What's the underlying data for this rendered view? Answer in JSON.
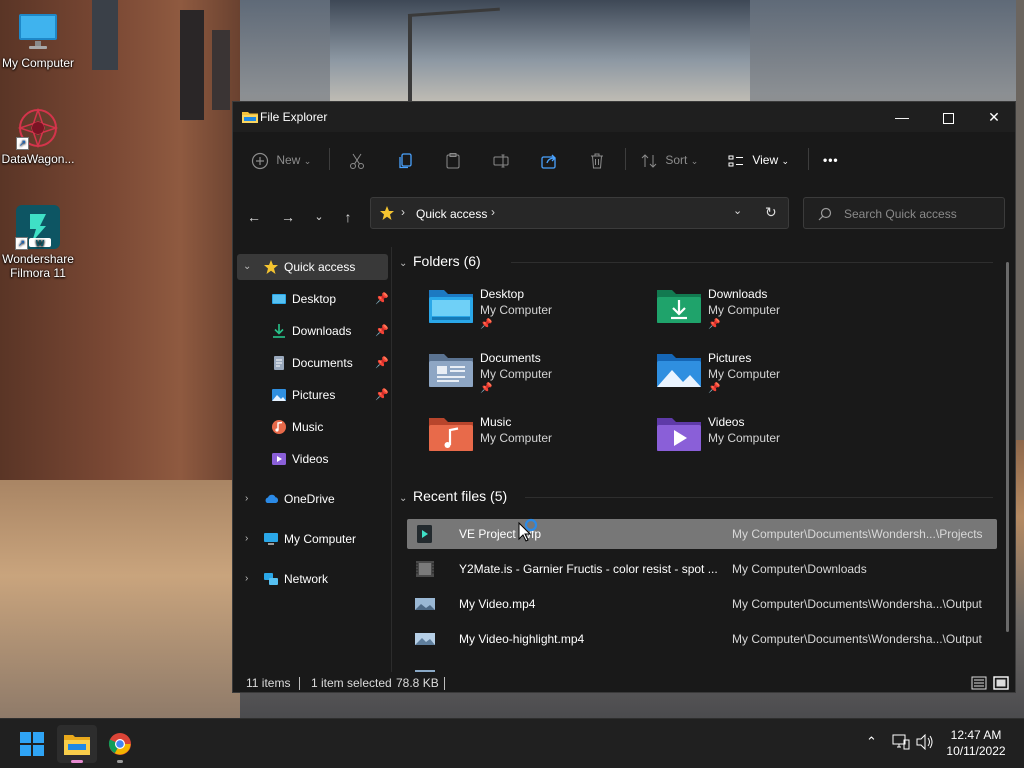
{
  "desktop": {
    "icons": [
      {
        "label": "My Computer",
        "icon": "monitor-icon"
      },
      {
        "label": "DataWagon...",
        "icon": "datawagon-app-icon"
      },
      {
        "label": "Wondershare Filmora 11",
        "icon": "filmora-app-icon"
      }
    ]
  },
  "window": {
    "title": "File Explorer",
    "toolbar": {
      "new_label": "New",
      "sort_label": "Sort",
      "view_label": "View",
      "more_label": "•••"
    },
    "address": {
      "crumb": "Quick access",
      "search_placeholder": "Search Quick access"
    },
    "nav": {
      "quick_access": "Quick access",
      "pinned": [
        {
          "label": "Desktop",
          "icon": "desktop-folder-icon",
          "pinned": true
        },
        {
          "label": "Downloads",
          "icon": "downloads-icon",
          "pinned": true
        },
        {
          "label": "Documents",
          "icon": "documents-icon",
          "pinned": true
        },
        {
          "label": "Pictures",
          "icon": "pictures-icon",
          "pinned": true
        },
        {
          "label": "Music",
          "icon": "music-icon",
          "pinned": false
        },
        {
          "label": "Videos",
          "icon": "videos-icon",
          "pinned": false
        }
      ],
      "onedrive": "OneDrive",
      "my_computer": "My Computer",
      "network": "Network"
    },
    "folders": {
      "heading": "Folders (6)",
      "items": [
        {
          "name": "Desktop",
          "location": "My Computer",
          "pinned": true,
          "color": "#2aa7e8"
        },
        {
          "name": "Downloads",
          "location": "My Computer",
          "pinned": true,
          "color": "#1fa36b"
        },
        {
          "name": "Documents",
          "location": "My Computer",
          "pinned": true,
          "color": "#7b95b5"
        },
        {
          "name": "Pictures",
          "location": "My Computer",
          "pinned": true,
          "color": "#2f8fe0"
        },
        {
          "name": "Music",
          "location": "My Computer",
          "pinned": false,
          "color": "#e86a4a"
        },
        {
          "name": "Videos",
          "location": "My Computer",
          "pinned": false,
          "color": "#8a5fd8"
        }
      ]
    },
    "recent": {
      "heading": "Recent files (5)",
      "items": [
        {
          "name": "VE Project .wfp",
          "path": "My Computer\\Documents\\Wondersh...\\Projects",
          "selected": true
        },
        {
          "name": "Y2Mate.is - Garnier Fructis - color resist - spot ...",
          "path": "My Computer\\Downloads",
          "selected": false
        },
        {
          "name": "My Video.mp4",
          "path": "My Computer\\Documents\\Wondersha...\\Output",
          "selected": false
        },
        {
          "name": "My Video-highlight.mp4",
          "path": "My Computer\\Documents\\Wondersha...\\Output",
          "selected": false
        }
      ]
    },
    "status": {
      "count": "11 items",
      "selection": "1 item selected",
      "size": "78.8 KB"
    }
  },
  "taskbar": {
    "time": "12:47 AM",
    "date": "10/11/2022"
  }
}
